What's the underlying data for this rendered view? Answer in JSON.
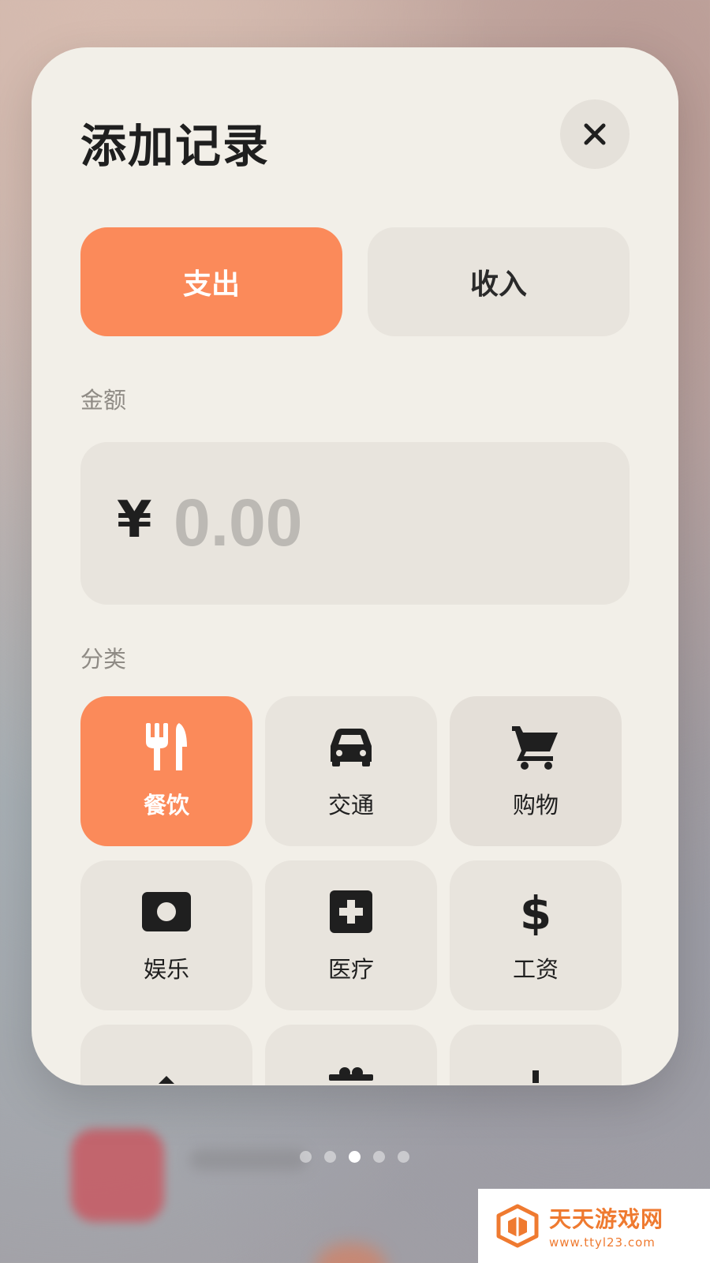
{
  "dialog": {
    "title": "添加记录",
    "close_icon": "close-icon"
  },
  "type_toggle": {
    "expense_label": "支出",
    "income_label": "收入",
    "selected": "expense"
  },
  "amount": {
    "label": "金额",
    "currency_symbol": "¥",
    "placeholder": "0.00",
    "value": ""
  },
  "category": {
    "label": "分类",
    "selected": "餐饮",
    "items": [
      {
        "label": "餐饮",
        "icon": "fork-knife-icon"
      },
      {
        "label": "交通",
        "icon": "car-icon"
      },
      {
        "label": "购物",
        "icon": "shopping-cart-icon"
      },
      {
        "label": "娱乐",
        "icon": "entertainment-icon"
      },
      {
        "label": "医疗",
        "icon": "medical-cross-icon"
      },
      {
        "label": "工资",
        "icon": "dollar-icon"
      }
    ]
  },
  "pager": {
    "count": 5,
    "active_index": 2
  },
  "watermark": {
    "title": "天天游戏网",
    "url": "www.ttyl23.com"
  },
  "colors": {
    "accent": "#fb8a5a",
    "card_bg": "#f2efe8",
    "tile_bg": "#e8e4dd",
    "text": "#1f1f1f",
    "placeholder": "#bcb9b4",
    "watermark": "#ef7a30"
  }
}
